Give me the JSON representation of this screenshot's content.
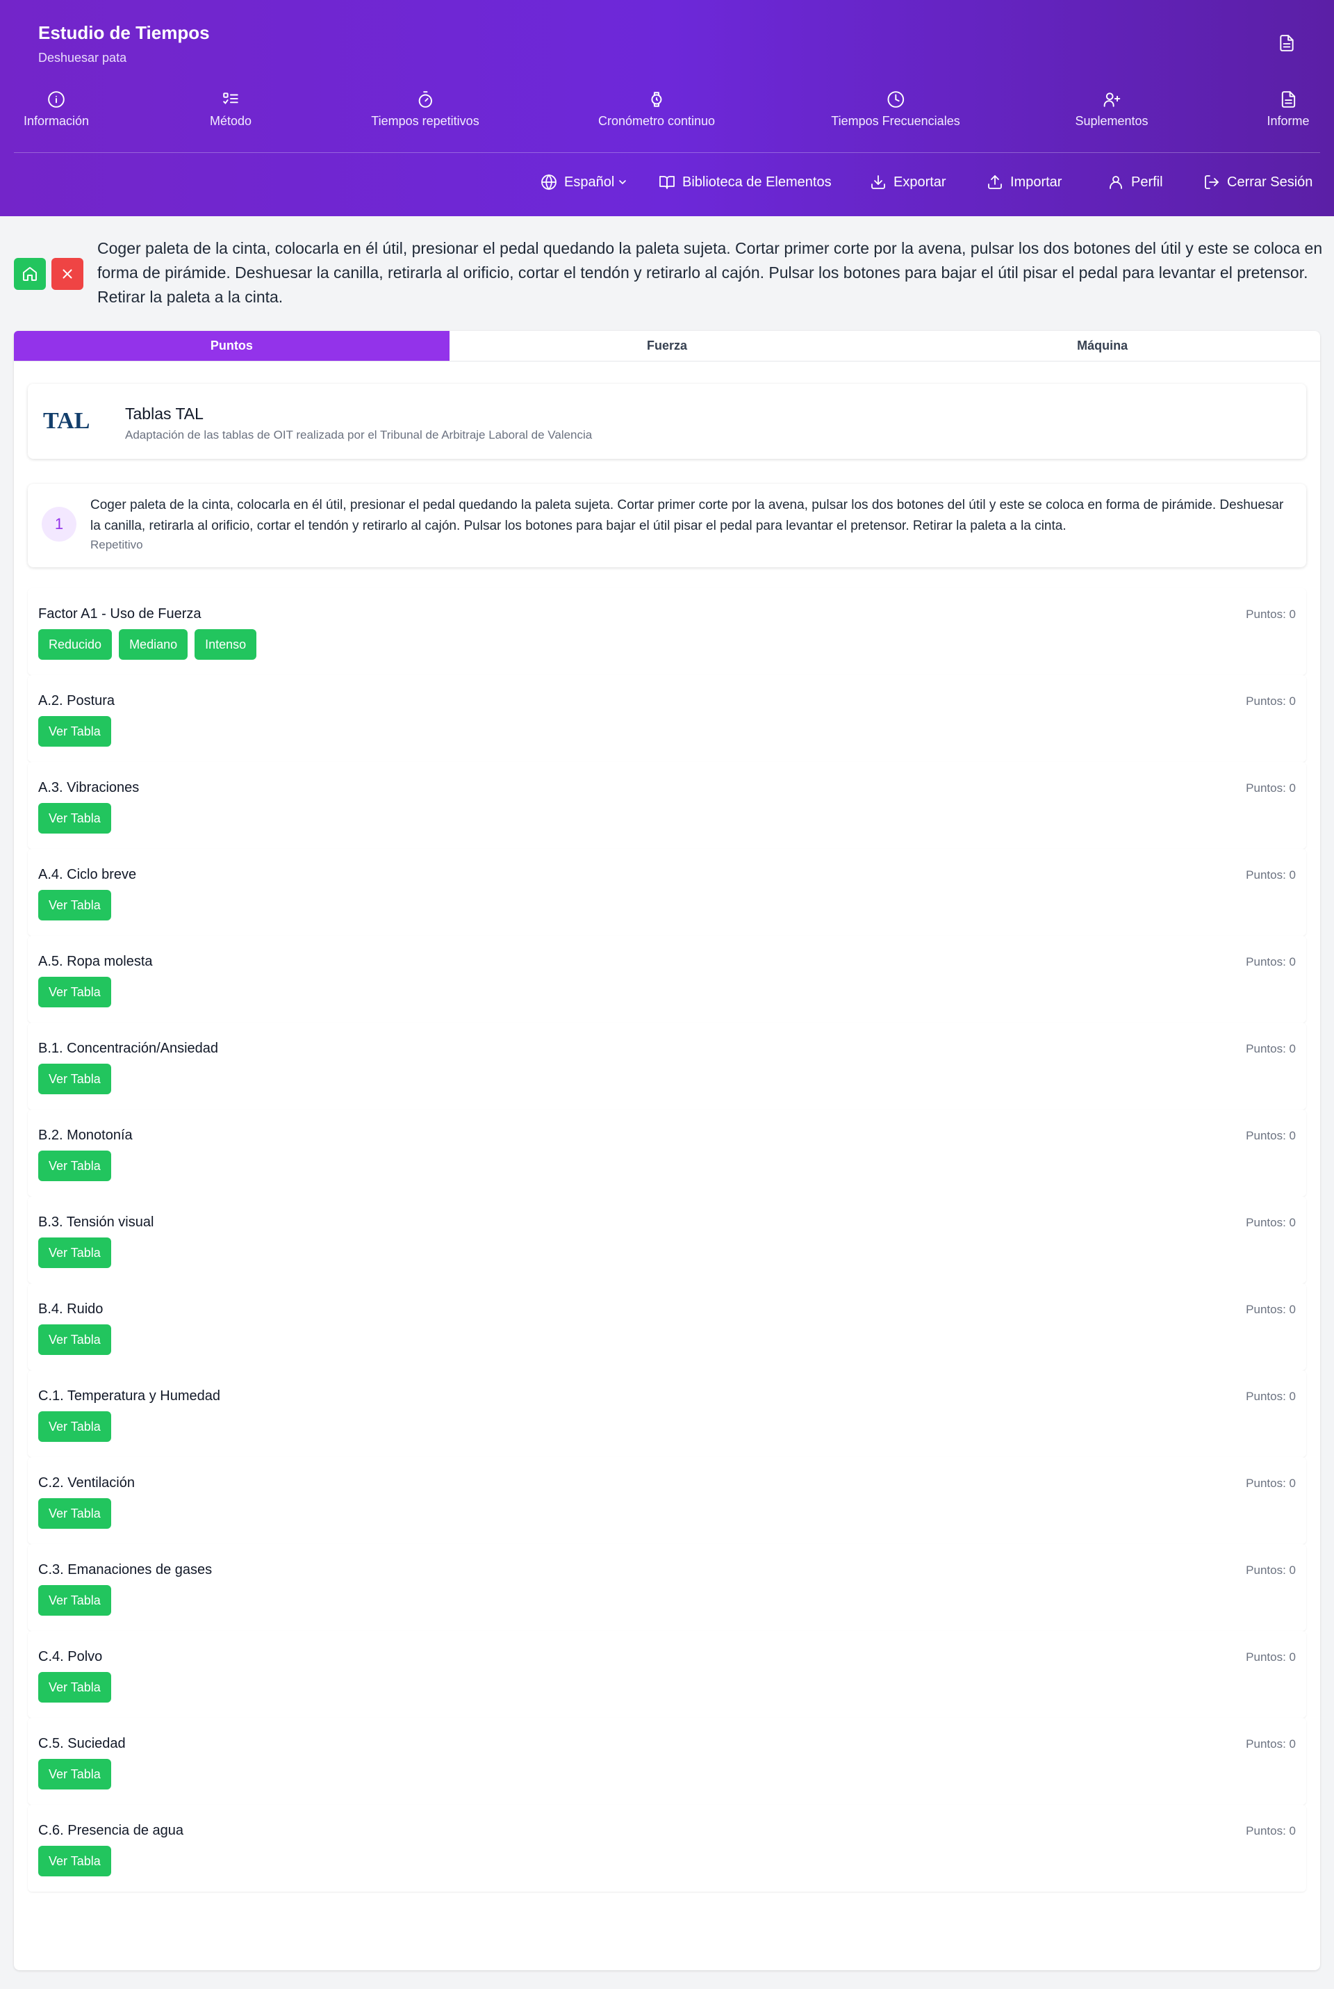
{
  "header": {
    "title": "Estudio de Tiempos",
    "subtitle": "Deshuesar pata",
    "nav": [
      {
        "label": "Información",
        "icon": "info-icon"
      },
      {
        "label": "Método",
        "icon": "list-check-icon"
      },
      {
        "label": "Tiempos repetitivos",
        "icon": "timer-icon"
      },
      {
        "label": "Cronómetro continuo",
        "icon": "watch-icon"
      },
      {
        "label": "Tiempos Frecuenciales",
        "icon": "clock-icon"
      },
      {
        "label": "Suplementos",
        "icon": "user-plus-icon"
      },
      {
        "label": "Informe",
        "icon": "file-text-icon"
      }
    ],
    "toolbar": {
      "language": "Español",
      "library": "Biblioteca de Elementos",
      "export": "Exportar",
      "import": "Importar",
      "profile": "Perfil",
      "logout": "Cerrar Sesión"
    }
  },
  "description": "Coger paleta de la cinta, colocarla en él útil, presionar el pedal quedando la paleta sujeta. Cortar primer corte por la avena, pulsar los dos botones del útil y este se coloca en forma de pirámide. Deshuesar la canilla, retirarla al orificio, cortar el tendón y retirarlo al cajón. Pulsar los botones para bajar el útil pisar el pedal para levantar el pretensor. Retirar la paleta a la cinta.",
  "tabs": [
    "Puntos",
    "Fuerza",
    "Máquina"
  ],
  "tal": {
    "logo_text": "TAL",
    "title": "Tablas TAL",
    "subtitle": "Adaptación de las tablas de OIT realizada por el Tribunal de Arbitraje Laboral de Valencia"
  },
  "task": {
    "number": "1",
    "text": "Coger paleta de la cinta, colocarla en él útil, presionar el pedal quedando la paleta sujeta. Cortar primer corte por la avena, pulsar los dos botones del útil y este se coloca en forma de pirámide. Deshuesar la canilla, retirarla al orificio, cortar el tendón y retirarlo al cajón. Pulsar los botones para bajar el útil pisar el pedal para levantar el pretensor. Retirar la paleta a la cinta.",
    "type": "Repetitivo"
  },
  "factors": [
    {
      "name": "Factor A1 - Uso de Fuerza",
      "points": "Puntos: 0",
      "buttons": [
        "Reducido",
        "Mediano",
        "Intenso"
      ]
    },
    {
      "name": "A.2. Postura",
      "points": "Puntos: 0",
      "buttons": [
        "Ver Tabla"
      ]
    },
    {
      "name": "A.3. Vibraciones",
      "points": "Puntos: 0",
      "buttons": [
        "Ver Tabla"
      ]
    },
    {
      "name": "A.4. Ciclo breve",
      "points": "Puntos: 0",
      "buttons": [
        "Ver Tabla"
      ]
    },
    {
      "name": "A.5. Ropa molesta",
      "points": "Puntos: 0",
      "buttons": [
        "Ver Tabla"
      ]
    },
    {
      "name": "B.1. Concentración/Ansiedad",
      "points": "Puntos: 0",
      "buttons": [
        "Ver Tabla"
      ]
    },
    {
      "name": "B.2. Monotonía",
      "points": "Puntos: 0",
      "buttons": [
        "Ver Tabla"
      ]
    },
    {
      "name": "B.3. Tensión visual",
      "points": "Puntos: 0",
      "buttons": [
        "Ver Tabla"
      ]
    },
    {
      "name": "B.4. Ruido",
      "points": "Puntos: 0",
      "buttons": [
        "Ver Tabla"
      ]
    },
    {
      "name": "C.1. Temperatura y Humedad",
      "points": "Puntos: 0",
      "buttons": [
        "Ver Tabla"
      ]
    },
    {
      "name": "C.2. Ventilación",
      "points": "Puntos: 0",
      "buttons": [
        "Ver Tabla"
      ]
    },
    {
      "name": "C.3. Emanaciones de gases",
      "points": "Puntos: 0",
      "buttons": [
        "Ver Tabla"
      ]
    },
    {
      "name": "C.4. Polvo",
      "points": "Puntos: 0",
      "buttons": [
        "Ver Tabla"
      ]
    },
    {
      "name": "C.5. Suciedad",
      "points": "Puntos: 0",
      "buttons": [
        "Ver Tabla"
      ]
    },
    {
      "name": "C.6. Presencia de agua",
      "points": "Puntos: 0",
      "buttons": [
        "Ver Tabla"
      ]
    }
  ],
  "colors": {
    "header": "#6d28d9",
    "tab_active": "#9333ea",
    "green": "#22c55e",
    "red": "#ef4444"
  }
}
